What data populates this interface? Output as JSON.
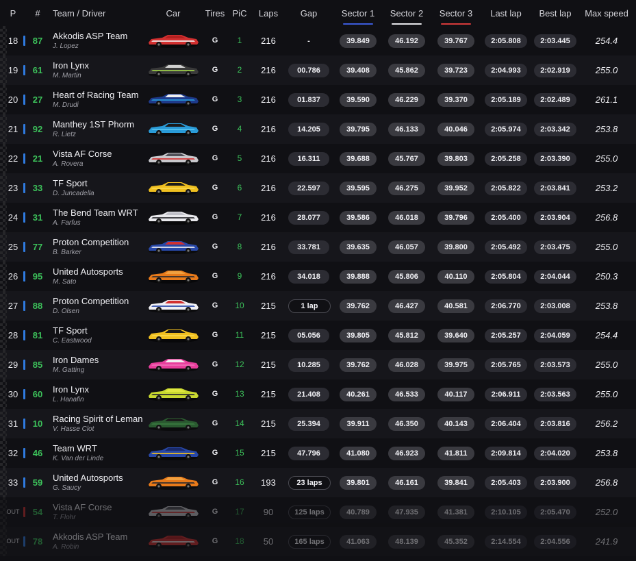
{
  "headers": {
    "p": "P",
    "num": "#",
    "team_driver": "Team / Driver",
    "car": "Car",
    "tires": "Tires",
    "pic": "PiC",
    "laps": "Laps",
    "gap": "Gap",
    "s1": "Sector 1",
    "s2": "Sector 2",
    "s3": "Sector 3",
    "last_lap": "Last lap",
    "best_lap": "Best lap",
    "max_speed": "Max speed"
  },
  "sector_colors": [
    "#3b5bdb",
    "#e6e6ea",
    "#d63a3a"
  ],
  "rows": [
    {
      "p": "18",
      "num": "87",
      "team": "Akkodis ASP Team",
      "driver": "J. Lopez",
      "tires": "G",
      "pic": "1",
      "laps": "216",
      "gap": "-",
      "s1": "39.849",
      "s2": "46.192",
      "s3": "39.767",
      "last": "2:05.808",
      "best": "2:03.445",
      "speed": "254.4",
      "bar": "#2f7be0",
      "car": [
        "#d23030",
        "#f0f0f0",
        "#b22020"
      ],
      "status": "running"
    },
    {
      "p": "19",
      "num": "61",
      "team": "Iron Lynx",
      "driver": "M. Martin",
      "tires": "G",
      "pic": "2",
      "laps": "216",
      "gap": "00.786",
      "s1": "39.408",
      "s2": "45.862",
      "s3": "39.723",
      "last": "2:04.993",
      "best": "2:02.919",
      "speed": "255.0",
      "bar": "#2f7be0",
      "car": [
        "#3a3a3a",
        "#9fd14a",
        "#d0d0d0"
      ],
      "status": "running"
    },
    {
      "p": "20",
      "num": "27",
      "team": "Heart of Racing Team",
      "driver": "M. Drudi",
      "tires": "G",
      "pic": "3",
      "laps": "216",
      "gap": "01.837",
      "s1": "39.590",
      "s2": "46.229",
      "s3": "39.370",
      "last": "2:05.189",
      "best": "2:02.489",
      "speed": "261.1",
      "bar": "#2f7be0",
      "car": [
        "#1e3a8a",
        "#2a9bd8",
        "#f0f0f0"
      ],
      "status": "running"
    },
    {
      "p": "21",
      "num": "92",
      "team": "Manthey 1ST Phorm",
      "driver": "R. Lietz",
      "tires": "G",
      "pic": "4",
      "laps": "216",
      "gap": "14.205",
      "s1": "39.795",
      "s2": "46.133",
      "s3": "40.046",
      "last": "2:05.974",
      "best": "2:03.342",
      "speed": "253.8",
      "bar": "#2f7be0",
      "car": [
        "#2a9bd8",
        "#58c6f0",
        "#1a1a1a"
      ],
      "status": "running"
    },
    {
      "p": "22",
      "num": "21",
      "team": "Vista AF Corse",
      "driver": "A. Rovera",
      "tires": "G",
      "pic": "5",
      "laps": "216",
      "gap": "16.311",
      "s1": "39.688",
      "s2": "45.767",
      "s3": "39.803",
      "last": "2:05.258",
      "best": "2:03.390",
      "speed": "255.0",
      "bar": "#2f7be0",
      "car": [
        "#c8c8cc",
        "#d23030",
        "#505058"
      ],
      "status": "running"
    },
    {
      "p": "23",
      "num": "33",
      "team": "TF Sport",
      "driver": "D. Juncadella",
      "tires": "G",
      "pic": "6",
      "laps": "216",
      "gap": "22.597",
      "s1": "39.595",
      "s2": "46.275",
      "s3": "39.952",
      "last": "2:05.822",
      "best": "2:03.841",
      "speed": "253.2",
      "bar": "#2f7be0",
      "car": [
        "#f0c020",
        "#f8d850",
        "#1a1a1a"
      ],
      "status": "running"
    },
    {
      "p": "24",
      "num": "31",
      "team": "The Bend Team WRT",
      "driver": "A. Farfus",
      "tires": "G",
      "pic": "7",
      "laps": "216",
      "gap": "28.077",
      "s1": "39.586",
      "s2": "46.018",
      "s3": "39.796",
      "last": "2:05.400",
      "best": "2:03.904",
      "speed": "256.8",
      "bar": "#2f7be0",
      "car": [
        "#e8e8ec",
        "#2a2a30",
        "#c0c0c8"
      ],
      "status": "running"
    },
    {
      "p": "25",
      "num": "77",
      "team": "Proton Competition",
      "driver": "B. Barker",
      "tires": "G",
      "pic": "8",
      "laps": "216",
      "gap": "33.781",
      "s1": "39.635",
      "s2": "46.057",
      "s3": "39.800",
      "last": "2:05.492",
      "best": "2:03.475",
      "speed": "255.0",
      "bar": "#2f7be0",
      "car": [
        "#2848a8",
        "#f0f0f0",
        "#d23030"
      ],
      "status": "running"
    },
    {
      "p": "26",
      "num": "95",
      "team": "United Autosports",
      "driver": "M. Sato",
      "tires": "G",
      "pic": "9",
      "laps": "216",
      "gap": "34.018",
      "s1": "39.888",
      "s2": "45.806",
      "s3": "40.110",
      "last": "2:05.804",
      "best": "2:04.044",
      "speed": "250.3",
      "bar": "#2f7be0",
      "car": [
        "#e87a1a",
        "#2a2a30",
        "#f0a040"
      ],
      "status": "running"
    },
    {
      "p": "27",
      "num": "88",
      "team": "Proton Competition",
      "driver": "D. Olsen",
      "tires": "G",
      "pic": "10",
      "laps": "215",
      "gap": "1 lap",
      "s1": "39.762",
      "s2": "46.427",
      "s3": "40.581",
      "last": "2:06.770",
      "best": "2:03.008",
      "speed": "253.8",
      "bar": "#2f7be0",
      "car": [
        "#f0f0f4",
        "#2848a8",
        "#d23030"
      ],
      "status": "lapdown"
    },
    {
      "p": "28",
      "num": "81",
      "team": "TF Sport",
      "driver": "C. Eastwood",
      "tires": "G",
      "pic": "11",
      "laps": "215",
      "gap": "05.056",
      "s1": "39.805",
      "s2": "45.812",
      "s3": "39.640",
      "last": "2:05.257",
      "best": "2:04.059",
      "speed": "254.4",
      "bar": "#2f7be0",
      "car": [
        "#f0c020",
        "#f8d850",
        "#1a1a1a"
      ],
      "status": "running"
    },
    {
      "p": "29",
      "num": "85",
      "team": "Iron Dames",
      "driver": "M. Gatting",
      "tires": "G",
      "pic": "12",
      "laps": "215",
      "gap": "10.285",
      "s1": "39.762",
      "s2": "46.028",
      "s3": "39.975",
      "last": "2:05.765",
      "best": "2:03.573",
      "speed": "255.0",
      "bar": "#2f7be0",
      "car": [
        "#e83e9c",
        "#f070b8",
        "#f0f0f0"
      ],
      "status": "running"
    },
    {
      "p": "30",
      "num": "60",
      "team": "Iron Lynx",
      "driver": "L. Hanafin",
      "tires": "G",
      "pic": "13",
      "laps": "215",
      "gap": "21.408",
      "s1": "40.261",
      "s2": "46.533",
      "s3": "40.117",
      "last": "2:06.911",
      "best": "2:03.563",
      "speed": "255.0",
      "bar": "#2f7be0",
      "car": [
        "#c8d830",
        "#2a2a30",
        "#e0e840"
      ],
      "status": "running"
    },
    {
      "p": "31",
      "num": "10",
      "team": "Racing Spirit of Leman",
      "driver": "V. Hasse Clot",
      "tires": "G",
      "pic": "14",
      "laps": "215",
      "gap": "25.394",
      "s1": "39.911",
      "s2": "46.350",
      "s3": "40.143",
      "last": "2:06.404",
      "best": "2:03.816",
      "speed": "256.2",
      "bar": "#2f7be0",
      "car": [
        "#2a5a30",
        "#3a7a40",
        "#1a1a1a"
      ],
      "status": "running"
    },
    {
      "p": "32",
      "num": "46",
      "team": "Team WRT",
      "driver": "K. Van der Linde",
      "tires": "G",
      "pic": "15",
      "laps": "215",
      "gap": "47.796",
      "s1": "41.080",
      "s2": "46.923",
      "s3": "41.811",
      "last": "2:09.814",
      "best": "2:04.020",
      "speed": "253.8",
      "bar": "#2f7be0",
      "car": [
        "#2848a8",
        "#f0c020",
        "#1a2a6a"
      ],
      "status": "running"
    },
    {
      "p": "33",
      "num": "59",
      "team": "United Autosports",
      "driver": "G. Saucy",
      "tires": "G",
      "pic": "16",
      "laps": "193",
      "gap": "23 laps",
      "s1": "39.801",
      "s2": "46.161",
      "s3": "39.841",
      "last": "2:05.403",
      "best": "2:03.900",
      "speed": "256.8",
      "bar": "#2f7be0",
      "car": [
        "#e87a1a",
        "#2a2a30",
        "#f0a040"
      ],
      "status": "lapdown"
    },
    {
      "p": "OUT",
      "num": "54",
      "team": "Vista AF Corse",
      "driver": "T. Flohr",
      "tires": "G",
      "pic": "17",
      "laps": "90",
      "gap": "125 laps",
      "s1": "40.789",
      "s2": "47.935",
      "s3": "41.381",
      "last": "2:10.105",
      "best": "2:05.470",
      "speed": "252.0",
      "bar": "#d23030",
      "car": [
        "#c8c8cc",
        "#d23030",
        "#505058"
      ],
      "status": "out"
    },
    {
      "p": "OUT",
      "num": "78",
      "team": "Akkodis ASP Team",
      "driver": "A. Robin",
      "tires": "G",
      "pic": "18",
      "laps": "50",
      "gap": "165 laps",
      "s1": "41.063",
      "s2": "48.139",
      "s3": "45.352",
      "last": "2:14.554",
      "best": "2:04.556",
      "speed": "241.9",
      "bar": "#2f7be0",
      "car": [
        "#d23030",
        "#f0f0f0",
        "#b22020"
      ],
      "status": "out"
    }
  ]
}
